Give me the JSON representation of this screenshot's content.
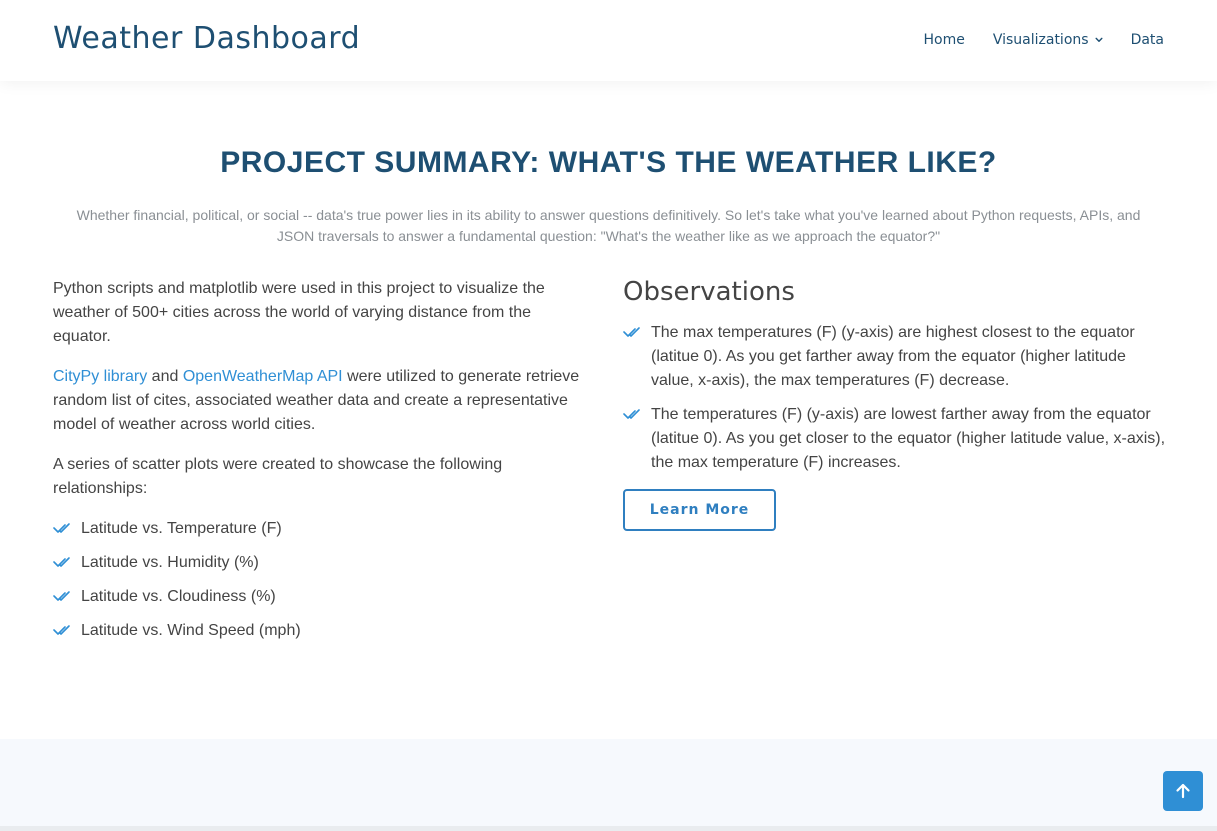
{
  "header": {
    "logo": "Weather Dashboard",
    "nav": {
      "home": "Home",
      "visualizations": "Visualizations",
      "data": "Data"
    }
  },
  "main": {
    "title": "PROJECT SUMMARY: WHAT'S THE WEATHER LIKE?",
    "subtitle": "Whether financial, political, or social -- data's true power lies in its ability to answer questions definitively. So let's take what you've learned about Python requests, APIs, and JSON traversals to answer a fundamental question: \"What's the weather like as we approach the equator?\"",
    "left": {
      "intro": "Python scripts and matplotlib were used in this project to visualize the weather of 500+ cities across the world of varying distance from the equator.",
      "citypy_link": "CityPy library",
      "and_text": " and ",
      "owm_link": "OpenWeatherMap API",
      "apis_rest": " were utilized to generate retrieve random list of cites, associated weather data and create a representative model of weather across world cities.",
      "series_text": "A series of scatter plots were created to showcase the following relationships:",
      "relationships": [
        "Latitude vs. Temperature (F)",
        "Latitude vs. Humidity (%)",
        "Latitude vs. Cloudiness (%)",
        "Latitude vs. Wind Speed (mph)"
      ]
    },
    "right": {
      "title": "Observations",
      "observations": [
        "The max temperatures (F) (y-axis) are highest closest to the equator (latitue 0). As you get farther away from the equator (higher latitude value, x-axis), the max temperatures (F) decrease.",
        "The temperatures (F) (y-axis) are lowest farther away from the equator (latitue 0). As you get closer to the equator (higher latitude value, x-axis), the max temperature (F) increases."
      ],
      "button": "Learn More"
    }
  },
  "icons": {
    "check": "double-check-icon",
    "chevron": "chevron-down-icon",
    "back_to_top": "arrow-up-icon"
  },
  "colors": {
    "brand": "#1e4f72",
    "accent": "#2f8fd5",
    "button_border": "#2f7fc0"
  }
}
